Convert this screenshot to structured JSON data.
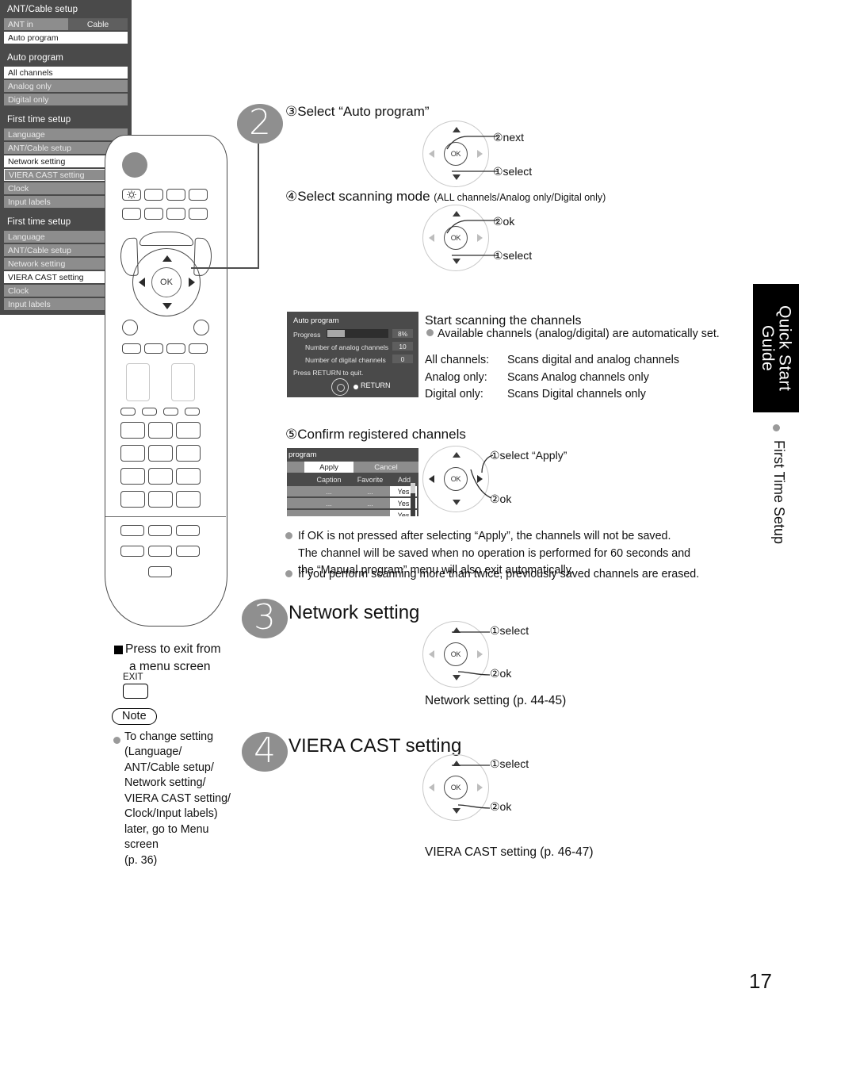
{
  "page": {
    "number": "17"
  },
  "side_tab": {
    "title_line1": "Quick Start",
    "title_line2": "Guide",
    "subtitle": "First Time Setup"
  },
  "steps": {
    "step2": {
      "number": "2"
    },
    "step3": {
      "number": "3",
      "heading": "Network setting"
    },
    "step4": {
      "number": "4",
      "heading": "VIERA CAST setting"
    }
  },
  "substep3": {
    "label_num": "③",
    "label": "Select “Auto program”",
    "dialog": {
      "title": "ANT/Cable setup",
      "rows": [
        {
          "label": "ANT in",
          "value": "Cable"
        },
        {
          "label": "Auto program",
          "value": ""
        }
      ]
    },
    "callouts": {
      "first": "①select",
      "second": "②next"
    }
  },
  "substep4": {
    "label_num": "④",
    "label": "Select scanning mode",
    "label_paren": "(ALL channels/Analog only/Digital only)",
    "dialog": {
      "title": "Auto program",
      "items": [
        "All channels",
        "Analog only",
        "Digital only"
      ],
      "selected": "All channels"
    },
    "callouts": {
      "first": "①select",
      "second": "②ok"
    }
  },
  "scanning": {
    "heading": "Start scanning the channels",
    "bullet": "Available channels (analog/digital) are automatically set.",
    "modes": [
      {
        "name": "All channels:",
        "desc": "Scans digital and analog channels"
      },
      {
        "name": "Analog only:",
        "desc": "Scans Analog channels only"
      },
      {
        "name": "Digital only:",
        "desc": "Scans Digital channels only"
      }
    ],
    "progress_dialog": {
      "title": "Auto program",
      "progress_label": "Progress",
      "progress_value": "8%",
      "progress_percent": 8,
      "analog_label": "Number of analog channels",
      "analog_value": "10",
      "digital_label": "Number of digital channels",
      "digital_value": "0",
      "quit_text": "Press RETURN to quit.",
      "return_label": "RETURN"
    }
  },
  "substep5": {
    "label_num": "⑤",
    "label": "Confirm registered channels",
    "dialog": {
      "title": "program",
      "apply_label": "Apply",
      "cancel_label": "Cancel",
      "columns": [
        "Caption",
        "Favorite",
        "Add"
      ],
      "rows": [
        {
          "caption": "...",
          "favorite": "...",
          "add": "Yes"
        },
        {
          "caption": "...",
          "favorite": "...",
          "add": "Yes"
        },
        {
          "caption": "...",
          "favorite": "...",
          "add": "Yes"
        }
      ]
    },
    "callouts": {
      "first": "①select “Apply”",
      "second": "②ok"
    }
  },
  "notes_main": [
    "If OK is not pressed after selecting “Apply”, the channels will not be saved.",
    "The channel will be saved when no operation is performed for 60 seconds and",
    "the “Manual program” menu will also exit automatically.",
    "If you perform scanning more than twice, previously saved channels are erased."
  ],
  "first_time_setup_menu": {
    "title": "First time setup",
    "items": [
      "Language",
      "ANT/Cable setup",
      "Network setting",
      "VIERA CAST setting",
      "Clock",
      "Input labels"
    ]
  },
  "step3_detail": {
    "selected_item": "Network setting",
    "boxed_item": "VIERA CAST setting",
    "callouts": {
      "first": "①select",
      "second": "②ok"
    },
    "reference": "Network setting (p. 44-45)"
  },
  "step4_detail": {
    "selected_item": "VIERA CAST setting",
    "callouts": {
      "first": "①select",
      "second": "②ok"
    },
    "reference": "VIERA CAST setting (p. 46-47)"
  },
  "left_panel": {
    "exit_heading_line1": "Press to exit from",
    "exit_heading_line2": "a menu screen",
    "exit_key_label": "EXIT",
    "note_label": "Note",
    "note_lines": [
      "To change setting",
      "(Language/",
      "ANT/Cable setup/",
      "Network setting/",
      "VIERA CAST setting/",
      "Clock/Input labels)",
      "later, go to Menu",
      "screen",
      "(p. 36)"
    ]
  },
  "remote": {
    "ok_label": "OK"
  },
  "colors": {
    "osd_bg": "#4a4a4a",
    "osd_row": "#8d8d8d",
    "osd_sel": "#ffffff",
    "bubble": "#8f8f8f",
    "tab_bg": "#000000"
  }
}
